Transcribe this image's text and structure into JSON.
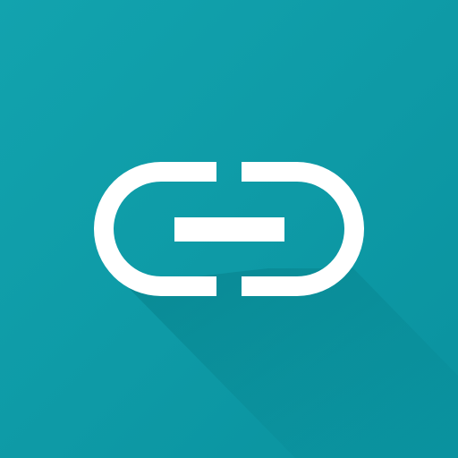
{
  "icon": {
    "name": "link-icon",
    "colors": {
      "background_light": "#12A3AE",
      "background_dark": "#0A929F",
      "shadow": "#067C86",
      "glyph": "#FFFFFF"
    }
  }
}
